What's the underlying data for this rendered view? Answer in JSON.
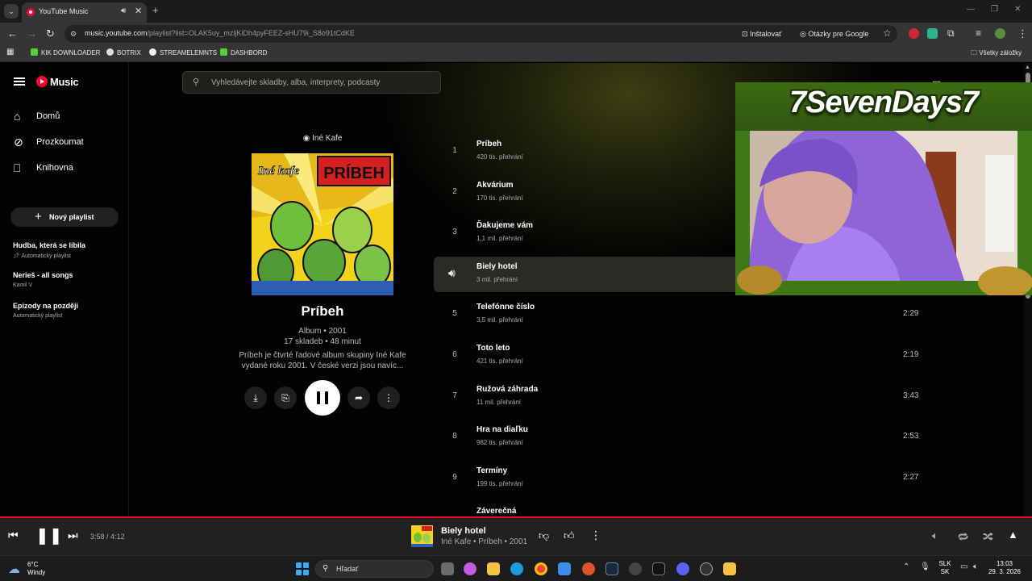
{
  "browser": {
    "tab_title": "YouTube Music",
    "url_host": "music.youtube.com",
    "url_path": "/playlist?list=OLAK5uy_mzljKiDh4pyFEEZ-sHU79i_S8o91tCdKE",
    "install_label": "Inštalovať",
    "ask_google_label": "Otázky pre Google",
    "bookmarks": [
      "KIK DOWNLOADER",
      "BOTRIX",
      "STREAMELEMNTS",
      "DASHBORD"
    ],
    "all_bookmarks_label": "Všetky záložky"
  },
  "sidebar": {
    "logo": "Music",
    "nav": [
      {
        "label": "Domů",
        "icon": "home-icon"
      },
      {
        "label": "Prozkoumat",
        "icon": "compass-icon"
      },
      {
        "label": "Knihovna",
        "icon": "library-icon"
      }
    ],
    "new_playlist_label": "Nový playlist",
    "playlists": [
      {
        "title": "Hudba, která se líbila",
        "sub": "Automatický playlist",
        "pinned": true
      },
      {
        "title": "Nerieš - all songs",
        "sub": "Kamil V",
        "pinned": false
      },
      {
        "title": "Epizody na později",
        "sub": "Automatický playlist",
        "pinned": false
      }
    ]
  },
  "search": {
    "placeholder": "Vyhledávejte skladby, alba, interprety, podcasty"
  },
  "album": {
    "artist": "Iné Kafe",
    "title": "Príbeh",
    "type_year": "Album • 2001",
    "count_length": "17 skladeb • 48 minut",
    "description_1": "Príbeh je čtvrté řadové album skupiny Iné Kafe",
    "description_2": "vydané roku 2001. V české verzi jsou navíc...",
    "cover_logo": "Iné kafe",
    "cover_title": "PRÍBEH"
  },
  "tracks": [
    {
      "num": "1",
      "title": "Príbeh",
      "plays": "420 tis. přehrání",
      "duration": ""
    },
    {
      "num": "2",
      "title": "Akvárium",
      "plays": "170 tis. přehrání",
      "duration": ""
    },
    {
      "num": "3",
      "title": "Ďakujeme vám",
      "plays": "1,1 mil. přehrání",
      "duration": ""
    },
    {
      "num": "4",
      "title": "Biely hotel",
      "plays": "3 mil. přehrání",
      "duration": ""
    },
    {
      "num": "5",
      "title": "Telefónne číslo",
      "plays": "3,5 mil. přehrání",
      "duration": "2:29"
    },
    {
      "num": "6",
      "title": "Toto leto",
      "plays": "421 tis. přehrání",
      "duration": "2:19"
    },
    {
      "num": "7",
      "title": "Ružová záhrada",
      "plays": "11 mil. přehrání",
      "duration": "3:43"
    },
    {
      "num": "8",
      "title": "Hra na diaľku",
      "plays": "962 tis. přehrání",
      "duration": "2:53"
    },
    {
      "num": "9",
      "title": "Termíny",
      "plays": "199 tis. přehrání",
      "duration": "2:27"
    },
    {
      "num": "",
      "title": "Záverečná",
      "plays": "",
      "duration": ""
    }
  ],
  "active_track": 4,
  "overlay": {
    "title": "7SevenDays7"
  },
  "player": {
    "time": "3:58 / 4:12",
    "title": "Biely hotel",
    "subtitle": "Iné Kafe • Príbeh • 2001"
  },
  "taskbar": {
    "temp": "6°C",
    "weather": "Windy",
    "search_label": "Hľadať",
    "lang_1": "SLK",
    "lang_2": "SK",
    "clock_time": "13:03",
    "clock_date": "29. 3. 2026"
  },
  "colors": {
    "accent": "#ff0033",
    "active_row": "#2b2b25"
  }
}
